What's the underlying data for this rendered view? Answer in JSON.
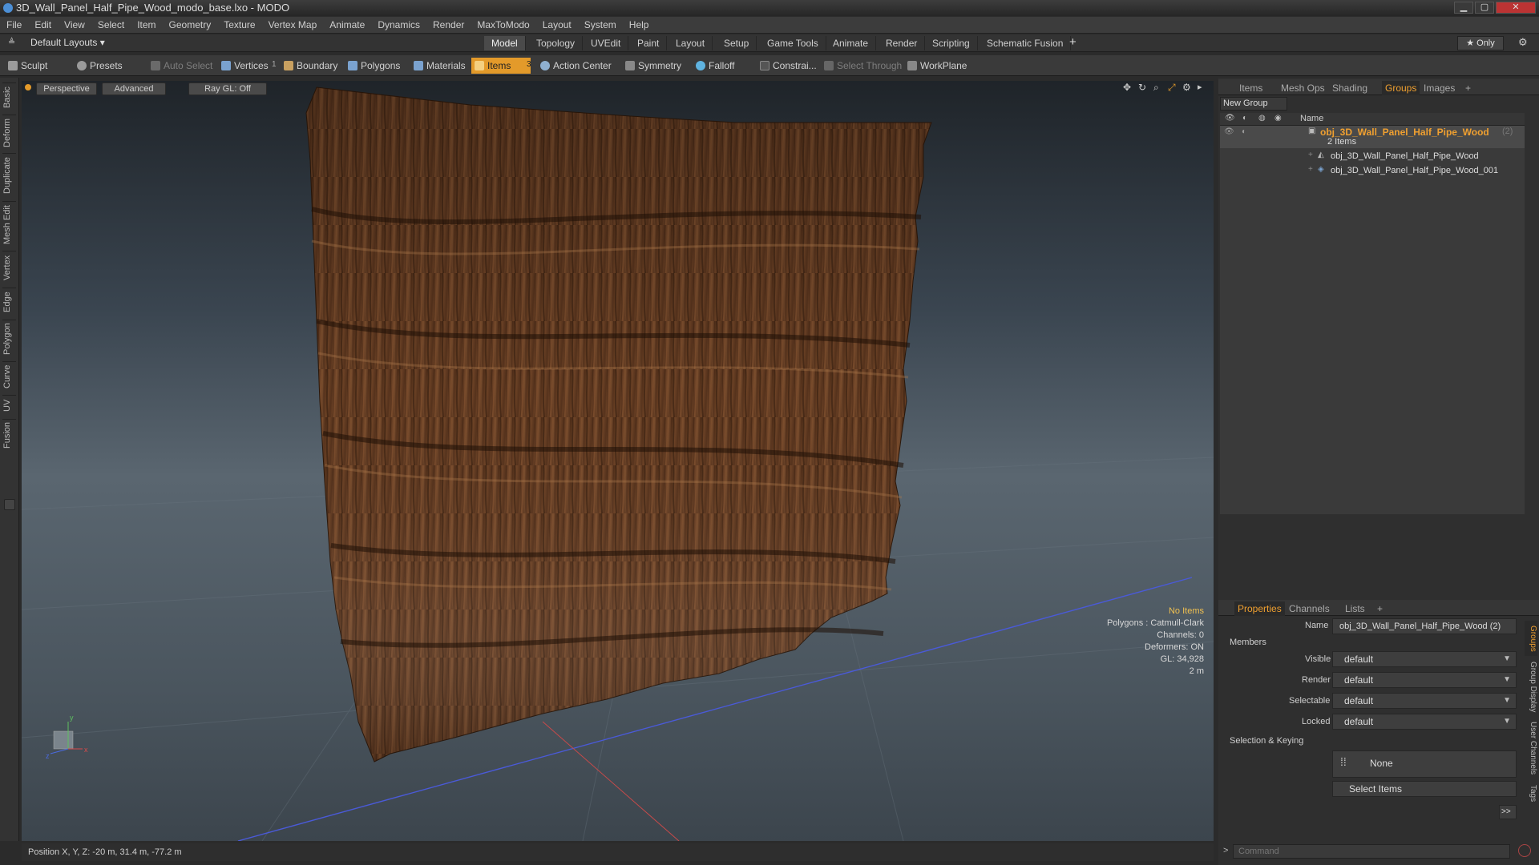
{
  "window": {
    "title": "3D_Wall_Panel_Half_Pipe_Wood_modo_base.lxo - MODO",
    "minimize": "▁",
    "maximize": "▢",
    "close": "✕"
  },
  "menu": [
    "File",
    "Edit",
    "View",
    "Select",
    "Item",
    "Geometry",
    "Texture",
    "Vertex Map",
    "Animate",
    "Dynamics",
    "Render",
    "MaxToModo",
    "Layout",
    "System",
    "Help"
  ],
  "layouts": {
    "selector": "Default Layouts ▾",
    "tabs": [
      "Model",
      "Topology",
      "UVEdit",
      "Paint",
      "Layout",
      "Setup",
      "Game Tools",
      "Animate",
      "Render",
      "Scripting",
      "Schematic Fusion"
    ],
    "add": "+",
    "only": "★  Only",
    "gear": "⚙"
  },
  "toolbar": {
    "sculpt": "Sculpt",
    "presets": "Presets",
    "auto_select": "Auto Select",
    "vertices": "Vertices",
    "vertices_count": "1",
    "boundary": "Boundary",
    "polygons": "Polygons",
    "materials": "Materials",
    "items": "Items",
    "items_count": "3",
    "action_center": "Action Center",
    "symmetry": "Symmetry",
    "falloff": "Falloff",
    "constraints": "Constrai...",
    "select_through": "Select Through",
    "workplane": "WorkPlane"
  },
  "left_tabs": [
    "Basic",
    "Deform",
    "Duplicate",
    "Mesh Edit",
    "Vertex",
    "Edge",
    "Polygon",
    "Curve",
    "UV",
    "Fusion"
  ],
  "viewport": {
    "perspective": "Perspective",
    "advanced": "Advanced",
    "raygl": "Ray GL: Off",
    "hud": {
      "no_items": "No Items",
      "polygons": "Polygons : Catmull-Clark",
      "channels": "Channels: 0",
      "deformers": "Deformers: ON",
      "gl": "GL: 34,928",
      "scale": "2 m"
    },
    "axis": {
      "x": "x",
      "y": "y",
      "z": "z"
    }
  },
  "status": {
    "position": "Position X, Y, Z:  -20 m, 31.4 m, -77.2 m"
  },
  "scene_panel": {
    "tabs": [
      "Items",
      "Mesh Ops",
      "Shading",
      "Groups",
      "Images"
    ],
    "active_tab": "Groups",
    "add": "+",
    "new_group": "New Group",
    "column_name": "Name",
    "group": {
      "name": "obj_3D_Wall_Panel_Half_Pipe_Wood",
      "count": "(2)",
      "sub": "2 Items"
    },
    "items": [
      "obj_3D_Wall_Panel_Half_Pipe_Wood",
      "obj_3D_Wall_Panel_Half_Pipe_Wood_001"
    ]
  },
  "properties": {
    "tabs": [
      "Properties",
      "Channels",
      "Lists"
    ],
    "add": "+",
    "name_label": "Name",
    "name_value": "obj_3D_Wall_Panel_Half_Pipe_Wood (2)",
    "members_header": "Members",
    "fields": [
      {
        "label": "Visible",
        "value": "default"
      },
      {
        "label": "Render",
        "value": "default"
      },
      {
        "label": "Selectable",
        "value": "default"
      },
      {
        "label": "Locked",
        "value": "default"
      }
    ],
    "selection_header": "Selection & Keying",
    "none_button": "None",
    "select_items_button": "Select Items",
    "more": ">>",
    "side_tabs": [
      "Groups",
      "Group Display",
      "User Channels",
      "Tags"
    ]
  },
  "command": {
    "placeholder": "Command",
    "prompt": ">"
  },
  "colors": {
    "accent": "#e39a2a",
    "group_name": "#f0a030",
    "wood_dark": "#3e2414",
    "wood_mid": "#6b3f22"
  }
}
